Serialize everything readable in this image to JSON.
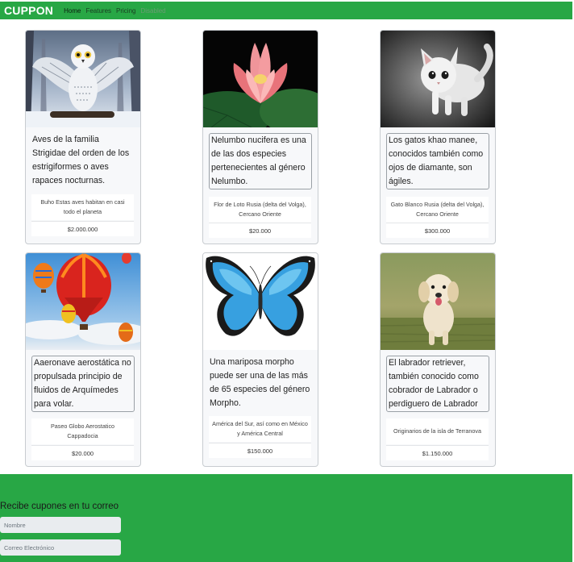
{
  "navbar": {
    "brand": "CUPPON",
    "links": [
      {
        "label": "Home",
        "state": "active"
      },
      {
        "label": "Features",
        "state": "normal"
      },
      {
        "label": "Pricing",
        "state": "normal"
      },
      {
        "label": "Disabled",
        "state": "disabled"
      }
    ]
  },
  "cards": [
    {
      "image_icon": "owl-icon",
      "text": "Aves de la familia Strigidae del orden de los estrigiformes o aves rapaces nocturnas.",
      "location": "Buho Estas aves habitan en casi todo el planeta",
      "price": "$2.000.000"
    },
    {
      "image_icon": "lotus-flower-icon",
      "text": "Nelumbo nucifera es una de las dos especies pertenecientes al género Nelumbo.",
      "location": "Flor de Loto Rusia (delta del Volga), Cercano Oriente",
      "price": "$20.000"
    },
    {
      "image_icon": "kitten-icon",
      "text": "Los gatos khao manee, conocidos también como ojos de diamante, son ágiles.",
      "location": "Gato Blanco Rusia (delta del Volga), Cercano Oriente",
      "price": "$300.000"
    },
    {
      "image_icon": "hot-air-balloon-icon",
      "text": "Aaeronave aerostática no propulsada principio de fluidos de Arquímedes para volar.",
      "location": "Paseo Globo Aerostatico Cappadocia",
      "price": "$20.000"
    },
    {
      "image_icon": "butterfly-icon",
      "text": "Una mariposa morpho puede ser una de las más de 65 especies del género Morpho.",
      "location": "América del Sur, así como en México y América Central",
      "price": "$150.000"
    },
    {
      "image_icon": "puppy-icon",
      "text": "El labrador retriever, también conocido como cobrador de Labrador o perdiguero de Labrador",
      "location": "Originarios de la isla de Terranova",
      "price": "$1.150.000"
    }
  ],
  "footer": {
    "title": "Recibe cupones en tu correo",
    "name_placeholder": "Nombre",
    "email_placeholder": "Correo Electrónico"
  },
  "colors": {
    "brand_green": "#28a745",
    "card_bg": "#f7f8fa"
  }
}
